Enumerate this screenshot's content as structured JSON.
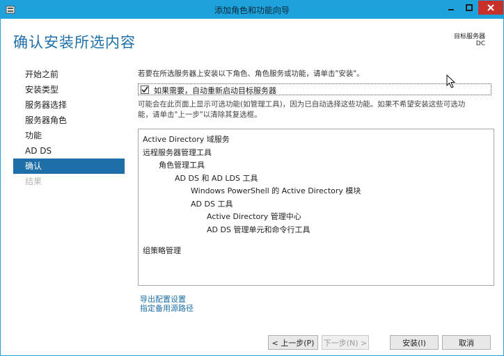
{
  "window": {
    "title": "添加角色和功能向导"
  },
  "header": {
    "page_title": "确认安装所选内容",
    "target_label": "目标服务器",
    "target_value": "DC"
  },
  "nav": {
    "items": [
      {
        "label": "开始之前",
        "state": "normal"
      },
      {
        "label": "安装类型",
        "state": "normal"
      },
      {
        "label": "服务器选择",
        "state": "normal"
      },
      {
        "label": "服务器角色",
        "state": "normal"
      },
      {
        "label": "功能",
        "state": "normal"
      },
      {
        "label": "AD DS",
        "state": "normal"
      },
      {
        "label": "确认",
        "state": "active"
      },
      {
        "label": "结果",
        "state": "disabled"
      }
    ]
  },
  "content": {
    "intro": "若要在所选服务器上安装以下角色、角色服务或功能，请单击\"安装\"。",
    "restart_checkbox_label": "如果需要，自动重新启动目标服务器",
    "restart_checked": true,
    "note_line1": "可能会在此页面上显示可选功能(如管理工具)，因为已自动选择这些功能。如果不希望安装这些可选功",
    "note_line2": "能，请单击\"上一步\"以清除其复选框。",
    "features": [
      {
        "label": "Active Directory 域服务",
        "level": 0
      },
      {
        "label": "远程服务器管理工具",
        "level": 0
      },
      {
        "label": "角色管理工具",
        "level": 1
      },
      {
        "label": "AD DS 和 AD LDS 工具",
        "level": 2
      },
      {
        "label": "Windows PowerShell 的 Active Directory 模块",
        "level": 3
      },
      {
        "label": "AD DS 工具",
        "level": 3
      },
      {
        "label": "Active Directory 管理中心",
        "level": 4
      },
      {
        "label": "AD DS 管理单元和命令行工具",
        "level": 4
      },
      {
        "label": "组策略管理",
        "level": 0
      }
    ],
    "export_link": "导出配置设置",
    "alt_source_link": "指定备用源路径"
  },
  "buttons": {
    "prev": "< 上一步(P)",
    "next": "下一步(N) >",
    "install": "安装(I)",
    "cancel": "取消"
  },
  "colors": {
    "titlebar": "#1ea2dc",
    "accent": "#1e6fa8",
    "close_button": "#c7312a"
  }
}
